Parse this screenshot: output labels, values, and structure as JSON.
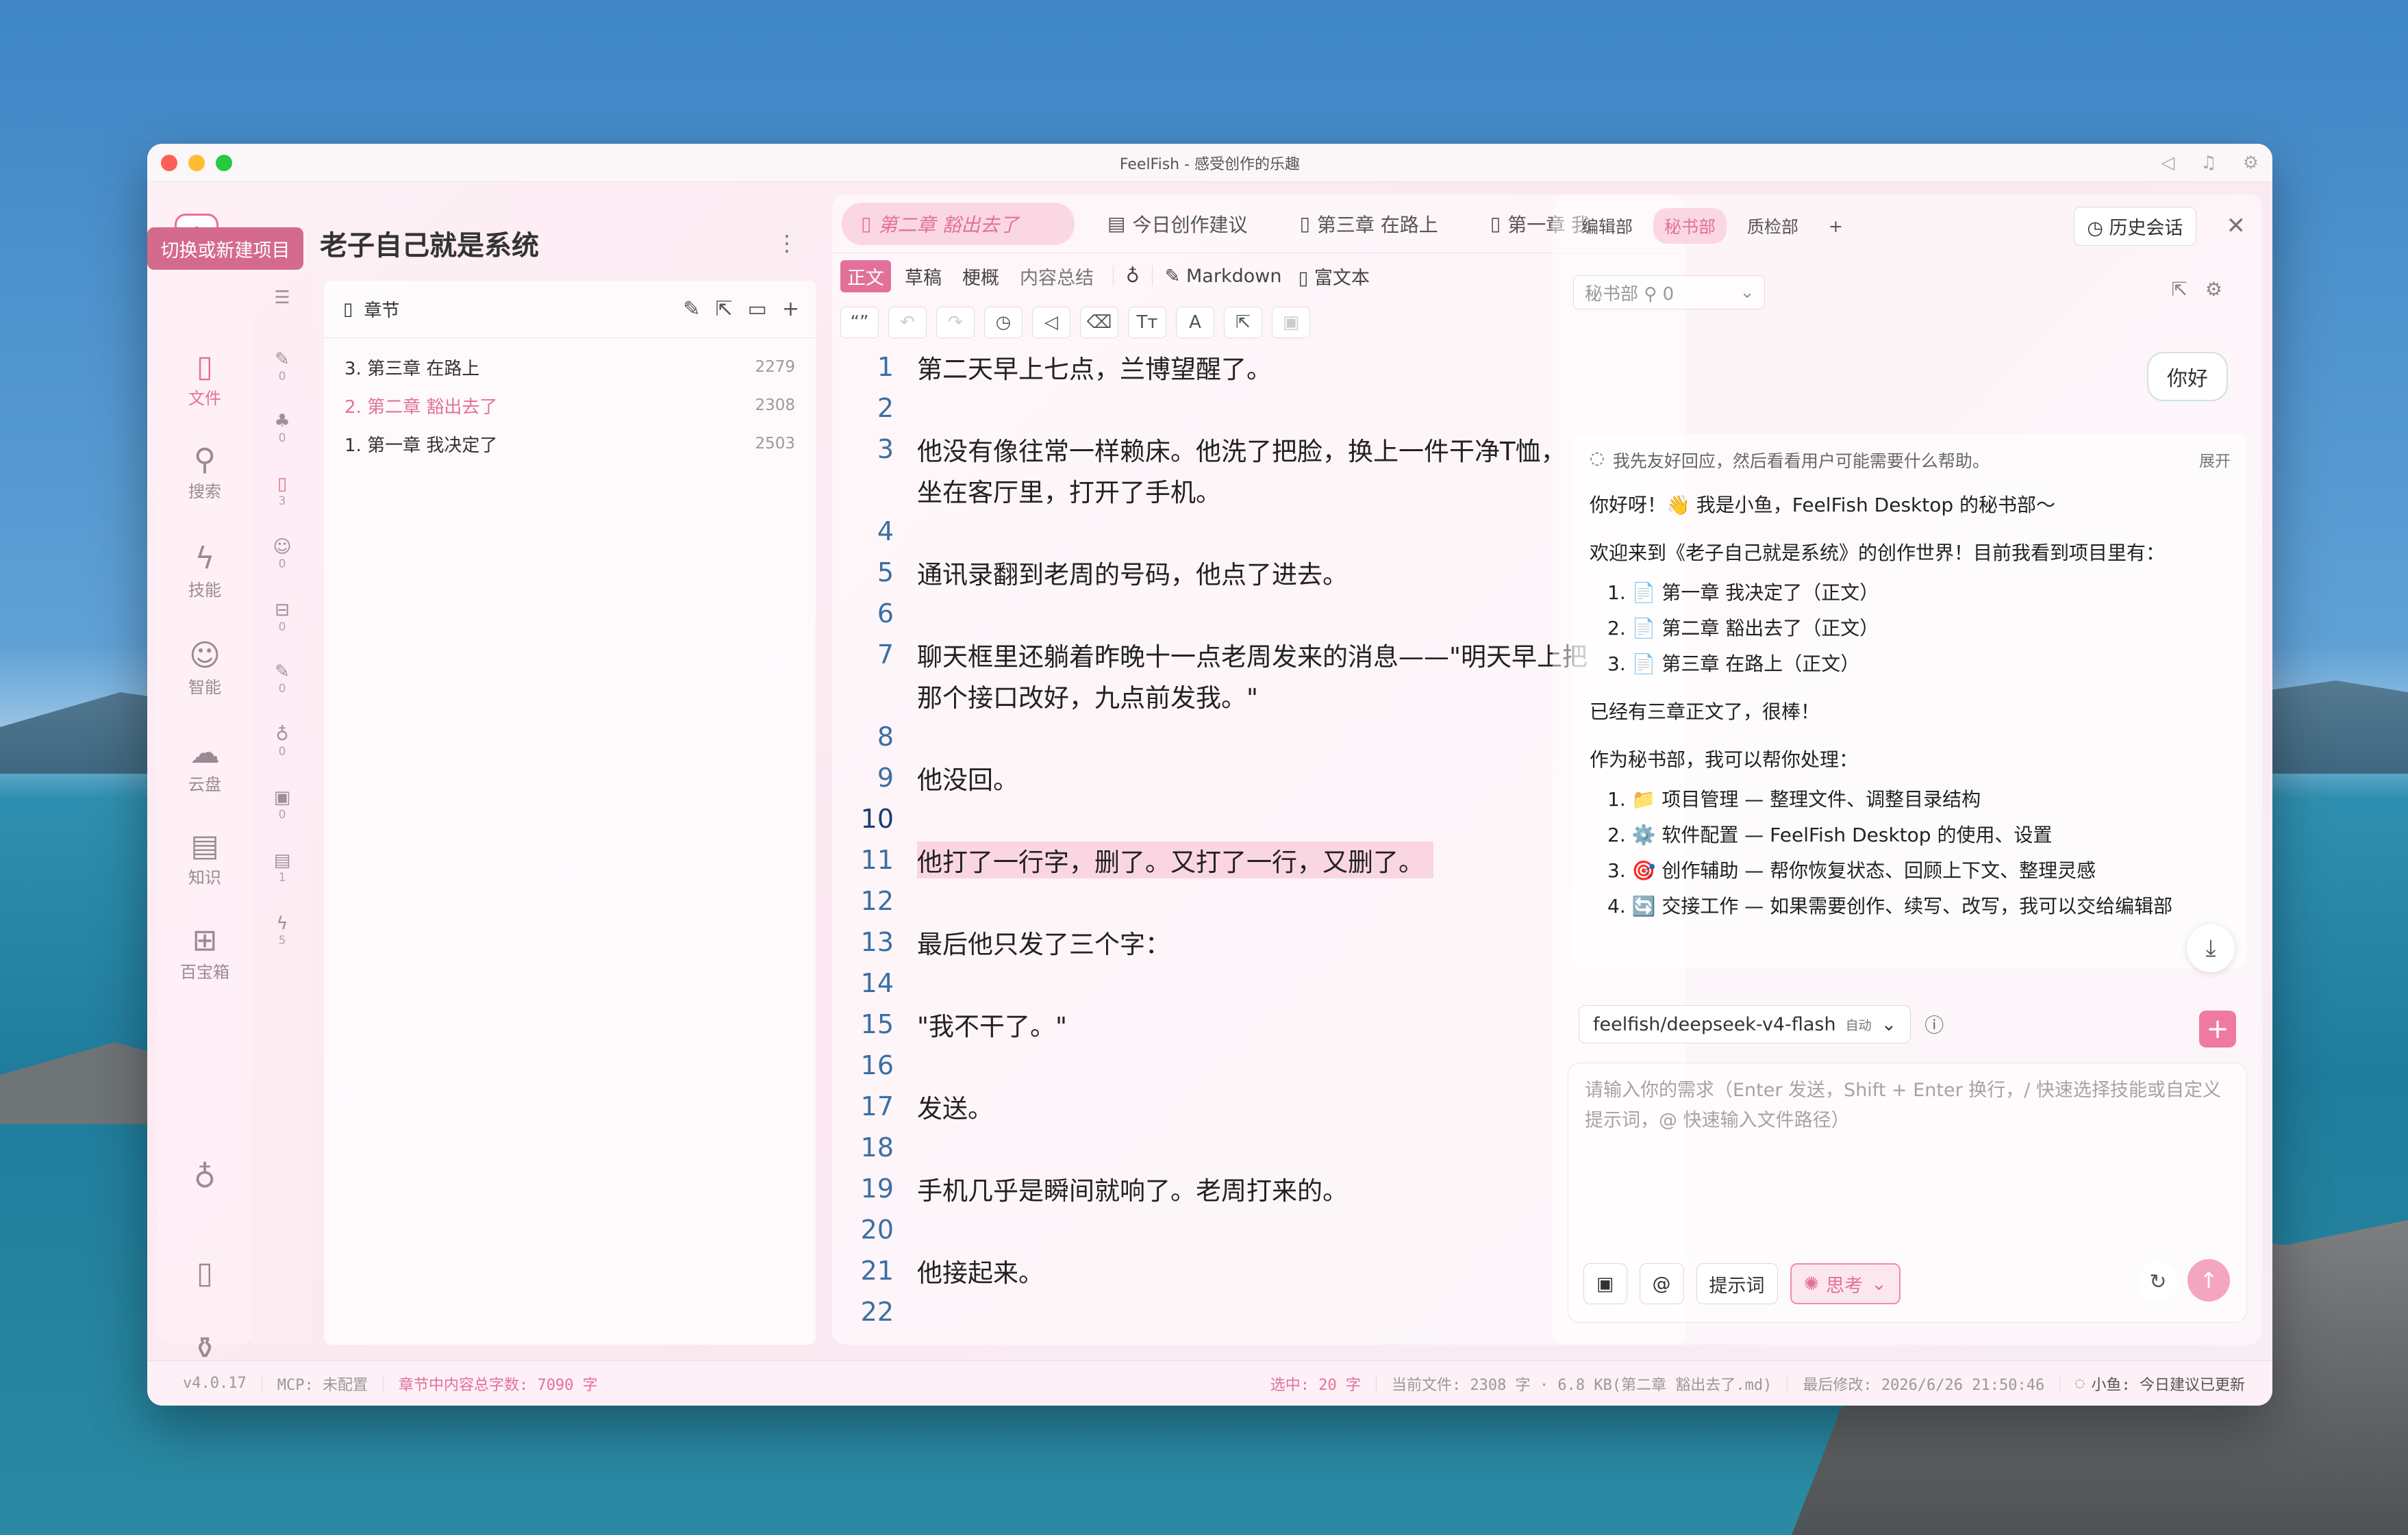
{
  "window": {
    "title": "FeelFish - 感受创作的乐趣"
  },
  "project": {
    "type": "小说",
    "name": "老子自己就是系统",
    "add_tooltip": "切换或新建项目"
  },
  "rail": [
    {
      "label": "文件",
      "icon": "file-icon",
      "active": true
    },
    {
      "label": "搜索",
      "icon": "search-icon"
    },
    {
      "label": "技能",
      "icon": "lightning-icon"
    },
    {
      "label": "智能",
      "icon": "robot-icon"
    },
    {
      "label": "云盘",
      "icon": "cloud-icon"
    },
    {
      "label": "知识",
      "icon": "book-icon"
    },
    {
      "label": "百宝箱",
      "icon": "grid-icon"
    }
  ],
  "subrail": [
    "0",
    "0",
    "3",
    "0",
    "0",
    "0",
    "0",
    "0",
    "1",
    "5"
  ],
  "chapters": {
    "header": "章节",
    "items": [
      {
        "title": "3. 第三章 在路上",
        "count": "2279"
      },
      {
        "title": "2. 第二章 豁出去了",
        "count": "2308"
      },
      {
        "title": "1. 第一章 我决定了",
        "count": "2503"
      }
    ]
  },
  "editor": {
    "tabs": [
      "第二章 豁出去了",
      "今日创作建议",
      "第三章 在路上",
      "第一章 我"
    ],
    "modes": [
      "正文",
      "草稿",
      "梗概",
      "内容总结"
    ],
    "markdown": "Markdown",
    "richtext": "富文本",
    "lines": [
      {
        "n": "1",
        "t": "第二天早上七点，兰博望醒了。"
      },
      {
        "n": "2",
        "t": ""
      },
      {
        "n": "3",
        "t": "他没有像往常一样赖床。他洗了把脸，换上一件干净T恤，"
      },
      {
        "n": "",
        "t": "坐在客厅里，打开了手机。"
      },
      {
        "n": "4",
        "t": ""
      },
      {
        "n": "5",
        "t": "通讯录翻到老周的号码，他点了进去。"
      },
      {
        "n": "6",
        "t": ""
      },
      {
        "n": "7",
        "t": "聊天框里还躺着昨晚十一点老周发来的消息——\"明天早上把"
      },
      {
        "n": "",
        "t": "那个接口改好，九点前发我。\""
      },
      {
        "n": "8",
        "t": ""
      },
      {
        "n": "9",
        "t": "他没回。"
      },
      {
        "n": "10",
        "t": ""
      },
      {
        "n": "11",
        "t": "他打了一行字，删了。又打了一行，又删了。"
      },
      {
        "n": "12",
        "t": ""
      },
      {
        "n": "13",
        "t": "最后他只发了三个字："
      },
      {
        "n": "14",
        "t": ""
      },
      {
        "n": "15",
        "t": "\"我不干了。\""
      },
      {
        "n": "16",
        "t": ""
      },
      {
        "n": "17",
        "t": "发送。"
      },
      {
        "n": "18",
        "t": ""
      },
      {
        "n": "19",
        "t": "手机几乎是瞬间就响了。老周打来的。"
      },
      {
        "n": "20",
        "t": ""
      },
      {
        "n": "21",
        "t": "他接起来。"
      },
      {
        "n": "22",
        "t": ""
      }
    ]
  },
  "chat": {
    "tabs": [
      "编辑部",
      "秘书部",
      "质检部"
    ],
    "history": "历史会话",
    "dept": "秘书部 ⚲ 0",
    "user_msg": "你好",
    "think": "我先友好回应，然后看看用户可能需要什么帮助。",
    "expand": "展开",
    "greeting": "你好呀！👋 我是小鱼，FeelFish Desktop 的秘书部～",
    "intro": "欢迎来到《老子自己就是系统》的创作世界！目前我看到项目里有：",
    "project_items": [
      "1. 📄 第一章 我决定了（正文）",
      "2. 📄 第二章 豁出去了（正文）",
      "3. 📄 第三章 在路上（正文）"
    ],
    "note": "已经有三章正文了，很棒！",
    "help_intro": "作为秘书部，我可以帮你处理：",
    "help_items": [
      "1. 📁 项目管理 — 整理文件、调整目录结构",
      "2. ⚙️ 软件配置 — FeelFish Desktop 的使用、设置",
      "3. 🎯 创作辅助 — 帮你恢复状态、回顾上下文、整理灵感",
      "4. 🔄 交接工作 — 如果需要创作、续写、改写，我可以交给编辑部"
    ],
    "model": "feelfish/deepseek-v4-flash",
    "model_auto": "自动",
    "input_placeholder": "请输入你的需求（Enter 发送，Shift + Enter 换行，/ 快速选择技能或自定义提示词，@ 快速输入文件路径）",
    "prompt_btn": "提示词",
    "think_btn": "思考"
  },
  "status": {
    "version": "v4.0.17",
    "mcp": "MCP: 未配置",
    "total": "章节中内容总字数: 7090 字",
    "selected": "选中: 20 字",
    "current": "当前文件: 2308 字 · 6.8 KB(第二章 豁出去了.md)",
    "modified": "最后修改: 2026/6/26 21:50:46",
    "assistant": "小鱼: 今日建议已更新"
  }
}
